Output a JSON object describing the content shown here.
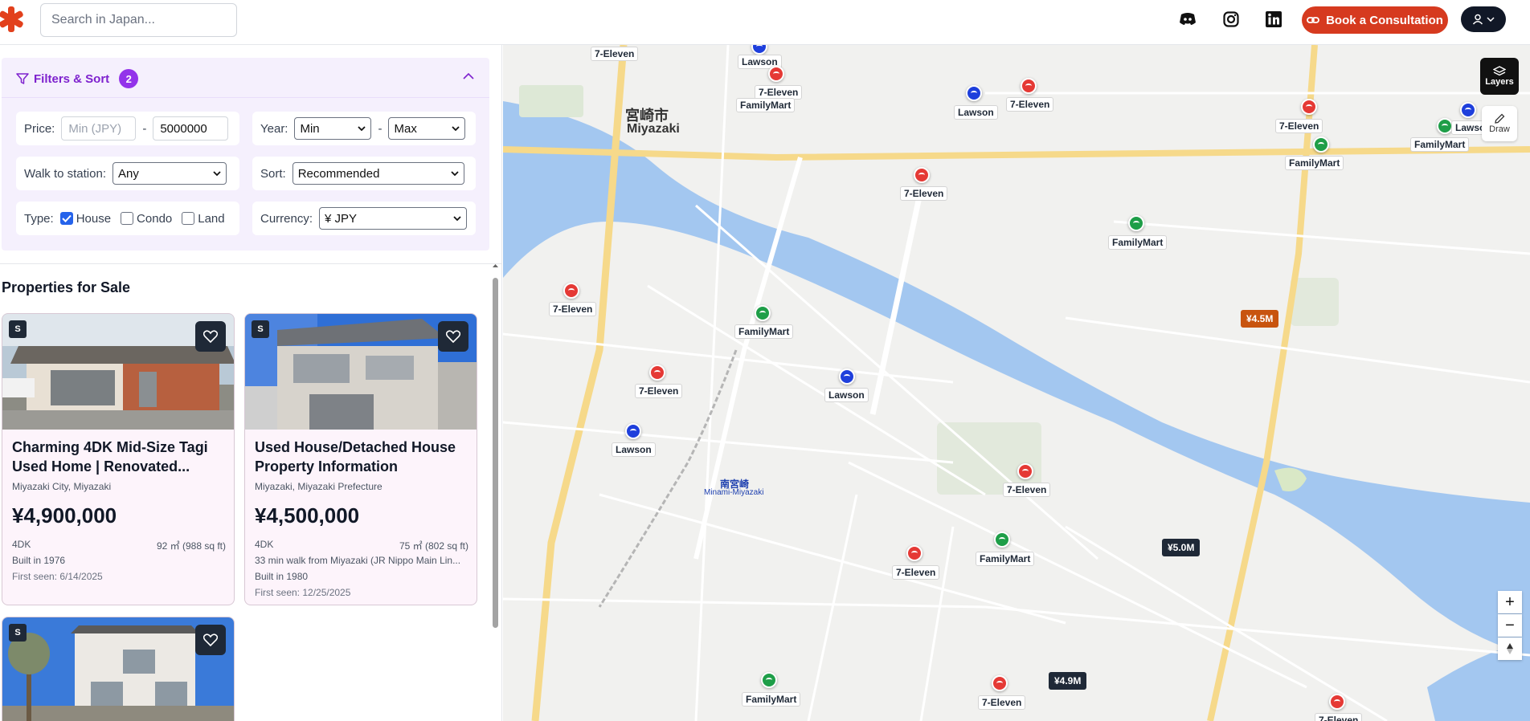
{
  "header": {
    "search_placeholder": "Search in Japan...",
    "consult_label": "Book a Consultation",
    "social": [
      "discord-icon",
      "instagram-icon",
      "linkedin-icon"
    ]
  },
  "filters": {
    "title": "Filters & Sort",
    "badge": "2",
    "price_label": "Price:",
    "price_min_placeholder": "Min (JPY)",
    "price_dash": "-",
    "price_max_value": "5000000",
    "year_label": "Year:",
    "year_min": "Min",
    "year_max": "Max",
    "walk_label": "Walk to station:",
    "walk_value": "Any",
    "sort_label": "Sort:",
    "sort_value": "Recommended",
    "type_label": "Type:",
    "type_house": "House",
    "type_condo": "Condo",
    "type_land": "Land",
    "currency_label": "Currency:",
    "currency_value": "¥ JPY"
  },
  "listings": {
    "title": "Properties for Sale",
    "cards": [
      {
        "badge": "S",
        "title": "Charming 4DK Mid-Size Tagi Used Home | Renovated...",
        "location": "Miyazaki City, Miyazaki",
        "price": "¥4,900,000",
        "layout": "4DK",
        "area": "92 ㎡ (988 sq ft)",
        "built": "Built in 1976",
        "seen": "First seen: 6/14/2025"
      },
      {
        "badge": "S",
        "title": "Used House/Detached House Property Information",
        "location": "Miyazaki, Miyazaki Prefecture",
        "price": "¥4,500,000",
        "layout": "4DK",
        "area": "75 ㎡ (802 sq ft)",
        "walk": "33 min walk from Miyazaki (JR Nippo Main Lin...",
        "built": "Built in 1980",
        "seen": "First seen: 12/25/2025"
      },
      {
        "badge": "S"
      }
    ]
  },
  "map": {
    "layers_label": "Layers",
    "draw_label": "Draw",
    "city_jp": "宮崎市",
    "city_en": "Miyazaki",
    "station_jp": "南宮崎",
    "station_en": "Minami-Miyazaki",
    "price_tags": [
      {
        "label": "¥4.5M",
        "color": "#c8540f"
      },
      {
        "label": "¥5.0M",
        "color": "#1f2937"
      },
      {
        "label": "¥4.9M",
        "color": "#1f2937"
      }
    ],
    "stores": {
      "seven": "7-Eleven",
      "family": "FamilyMart",
      "lawson": "Lawson"
    }
  }
}
